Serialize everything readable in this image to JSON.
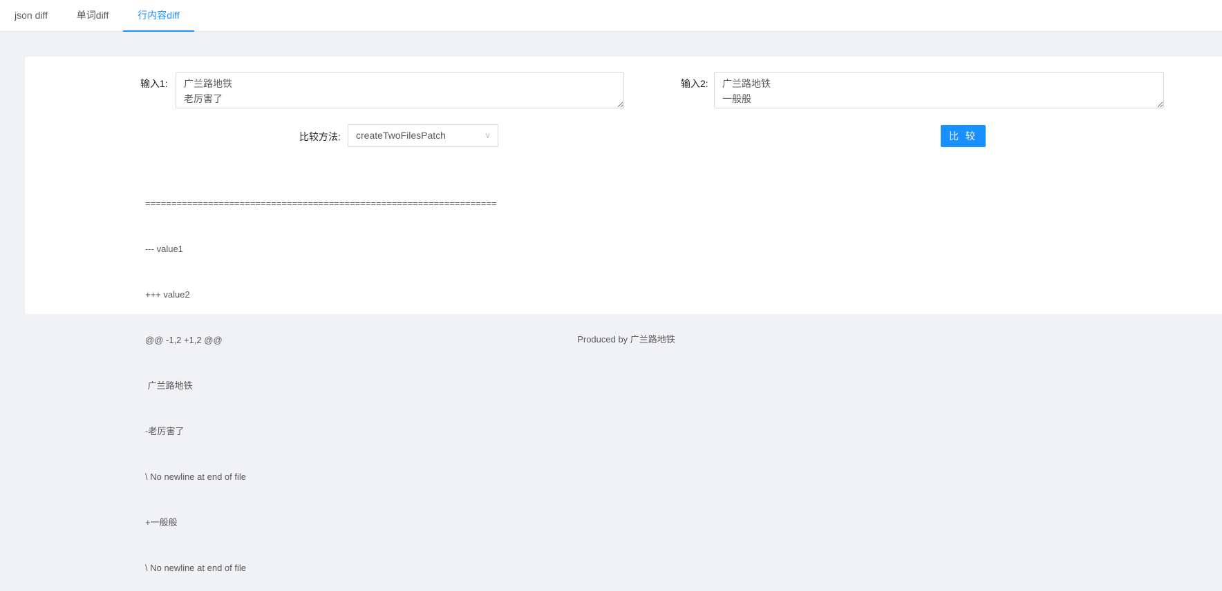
{
  "tabs": [
    {
      "label": "json diff"
    },
    {
      "label": "单词diff"
    },
    {
      "label": "行内容diff"
    }
  ],
  "form": {
    "input1_label": "输入1:",
    "input1_value": "广兰路地铁\n老厉害了",
    "input2_label": "输入2:",
    "input2_value": "广兰路地铁\n一般般",
    "method_label": "比较方法:",
    "method_value": "createTwoFilesPatch",
    "compare_label": "比 较"
  },
  "output": {
    "lines": [
      "===================================================================",
      "--- value1",
      "+++ value2",
      "@@ -1,2 +1,2 @@",
      " 广兰路地铁",
      "-老厉害了",
      "\\ No newline at end of file",
      "+一般般",
      "\\ No newline at end of file"
    ]
  },
  "footer": {
    "text": "Produced by 广兰路地铁"
  },
  "colors": {
    "accent": "#1890ff",
    "background": "#f0f2f5"
  }
}
